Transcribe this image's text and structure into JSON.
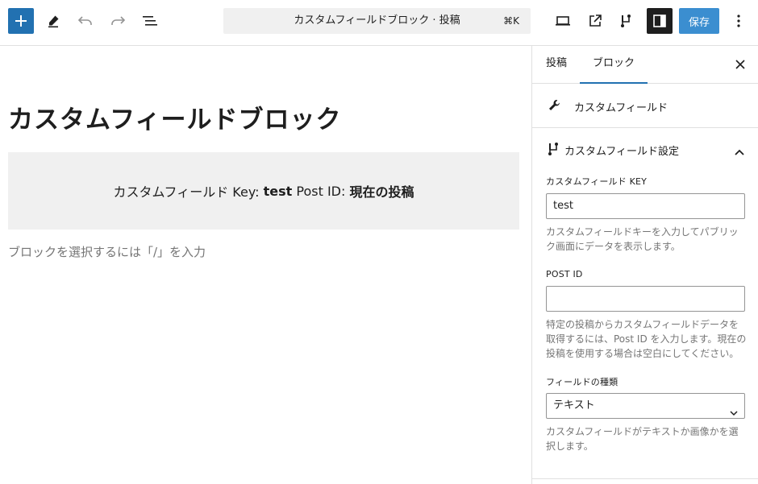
{
  "toolbar": {
    "add_icon": "plus-icon",
    "tools_icon": "pencil-icon",
    "undo_icon": "undo-icon",
    "redo_icon": "redo-icon",
    "list_view_icon": "list-view-icon",
    "command_title": "カスタムフィールドブロック · 投稿",
    "command_shortcut": "⌘K",
    "preview_icon": "laptop-icon",
    "view_post_icon": "external-link-icon",
    "block_icon": "custom-field-icon",
    "settings_icon": "sidebar-toggle-icon",
    "save_label": "保存",
    "more_icon": "vertical-ellipsis-icon",
    "accent_color": "#2271b1"
  },
  "editor": {
    "post_title": "カスタムフィールドブロック",
    "block_text": {
      "prefix": "カスタムフィールド Key:",
      "key_value": "test",
      "post_id_label": "Post ID:",
      "post_id_value": "現在の投稿"
    },
    "placeholder": "ブロックを選択するには「/」を入力"
  },
  "sidebar": {
    "tabs": [
      {
        "label": "投稿",
        "active": false
      },
      {
        "label": "ブロック",
        "active": true
      }
    ],
    "close_icon": "close-icon",
    "block_card": {
      "icon": "wrench-icon",
      "name": "カスタムフィールド"
    },
    "panel": {
      "icon": "custom-field-icon",
      "title": "カスタムフィールド設定",
      "toggle_icon": "chevron-up-icon",
      "key_label": "カスタムフィールド KEY",
      "key_value": "test",
      "key_help": "カスタムフィールドキーを入力してパブリック画面にデータを表示します。",
      "post_id_label": "POST ID",
      "post_id_value": "",
      "post_id_help": "特定の投稿からカスタムフィールドデータを取得するには、Post ID を入力します。現在の投稿を使用する場合は空白にしてください。",
      "type_label": "フィールドの種類",
      "type_value": "テキスト",
      "type_help": "カスタムフィールドがテキストか画像かを選択します。"
    }
  }
}
